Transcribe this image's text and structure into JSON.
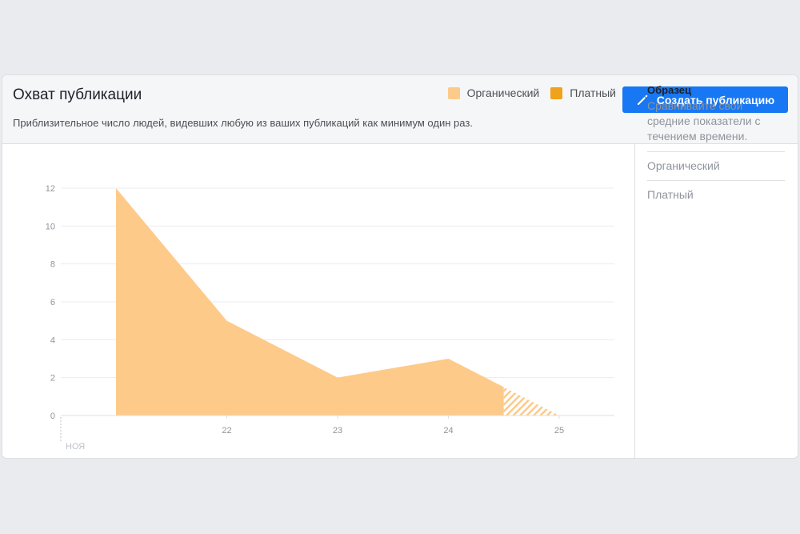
{
  "header": {
    "title": "Охват публикации",
    "subtitle": "Приблизительное число людей, видевших любую из ваших публикаций как минимум один раз.",
    "create_button_label": "Создать публикацию",
    "create_button_icon": "pencil-icon"
  },
  "sidebar": {
    "title": "Образец",
    "description": "Сравнивайте свои средние показатели с течением времени.",
    "items": [
      "Органический",
      "Платный"
    ]
  },
  "colors": {
    "organic": "#fdca8a",
    "paid": "#f0a21b",
    "button": "#1877f2",
    "grid": "#e9ebee",
    "axis_text": "#90949c"
  },
  "chart_data": {
    "type": "area",
    "x": [
      21,
      22,
      23,
      24,
      25
    ],
    "xticks": [
      "22",
      "23",
      "24",
      "25"
    ],
    "xaxis_sublabel": "НОЯ",
    "yticks": [
      "0",
      "2",
      "4",
      "6",
      "8",
      "10",
      "12"
    ],
    "ylim": [
      0,
      12
    ],
    "series": [
      {
        "name": "Органический",
        "points": [
          [
            21,
            12
          ],
          [
            22,
            5
          ],
          [
            23,
            2
          ],
          [
            24,
            3
          ],
          [
            24.5,
            1.5
          ]
        ],
        "projected": [
          [
            24.5,
            1.5
          ],
          [
            25,
            0
          ]
        ]
      },
      {
        "name": "Платный",
        "points": []
      }
    ],
    "legend": [
      "Органический",
      "Платный"
    ],
    "legend_position": "top-right",
    "grid": true
  }
}
